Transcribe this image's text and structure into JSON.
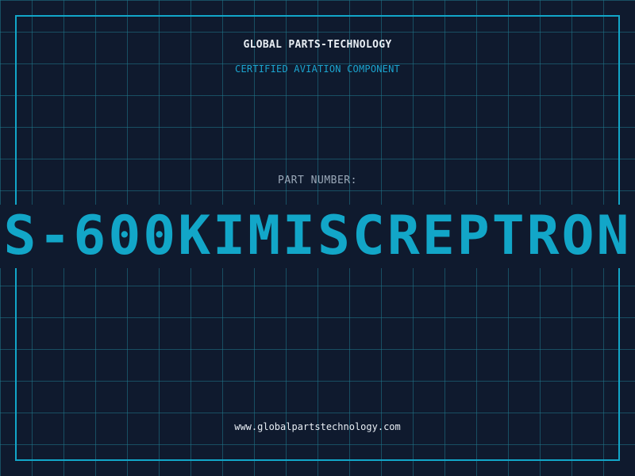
{
  "header": {
    "company": "GLOBAL PARTS-TECHNOLOGY",
    "tagline": "CERTIFIED AVIATION COMPONENT"
  },
  "part": {
    "label": "PART NUMBER:",
    "number": "S-600KIMISCREPTRON"
  },
  "footer": {
    "website": "www.globalpartstechnology.com"
  },
  "colors": {
    "background": "#0f1a2e",
    "grid": "#20788c",
    "accent": "#12a6c8",
    "text": "#e8eef4",
    "muted": "#9aa8b8"
  }
}
